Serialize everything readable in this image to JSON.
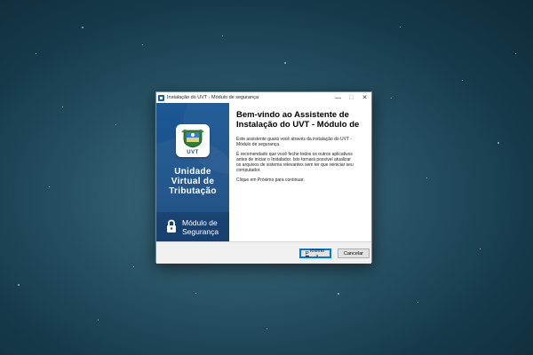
{
  "window": {
    "title": "Instalação do UVT - Módulo de segurança",
    "controls": {
      "minimize": "—",
      "maximize": "☐",
      "close": "✕"
    }
  },
  "sidebar": {
    "crest_label": "UVT",
    "brand_lines": [
      "Unidade",
      "Virtual de",
      "Tributação"
    ],
    "module_lines": [
      "Módulo de",
      "Segurança"
    ]
  },
  "content": {
    "heading_lines": [
      "Bem-vindo ao Assistente de",
      "Instalação do UVT - Módulo de"
    ],
    "p1": [
      "Este assistente guará você através da instalação do UVT -",
      "Módulo de segurança."
    ],
    "p2": [
      "É recomendado que você feche todos os outros aplicativos",
      "antes de iniciar o Instalador. Isto tornará possível atualizar",
      "os arquivos de sistema relevantes sem ter que reiniciar seu",
      "computador."
    ],
    "p3": "Clique em Próximo para continuar."
  },
  "buttons": {
    "next_mnemonic": "P",
    "next_rest": "róximo >",
    "cancel": "Cancelar"
  },
  "colors": {
    "sidebar": "#1c5894",
    "accent": "#0078d7",
    "desktop": "#2a5668"
  }
}
